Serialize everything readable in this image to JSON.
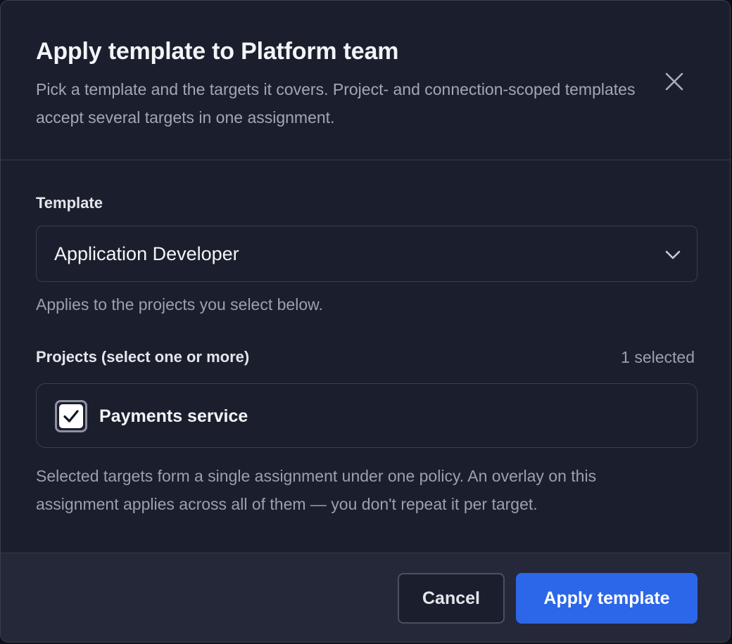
{
  "dialog": {
    "title": "Apply template to Platform team",
    "subtitle": "Pick a template and the targets it covers. Project- and connection-scoped templates accept several targets in one assignment.",
    "close_icon": "close-icon"
  },
  "template": {
    "label": "Template",
    "selected_value": "Application Developer",
    "chevron_icon": "chevron-down-icon",
    "hint": "Applies to the projects you select below."
  },
  "projects": {
    "label": "Projects (select one or more)",
    "selected_count": "1 selected",
    "items": [
      {
        "label": "Payments service",
        "checked": true
      }
    ],
    "note": "Selected targets form a single assignment under one policy. An overlay on this assignment applies across all of them — you don't repeat it per target."
  },
  "footer": {
    "cancel_label": "Cancel",
    "apply_label": "Apply template"
  },
  "colors": {
    "background": "#1b1f2d",
    "footer": "#242839",
    "accent": "#2c67ea",
    "border": "#3a3f4e"
  }
}
